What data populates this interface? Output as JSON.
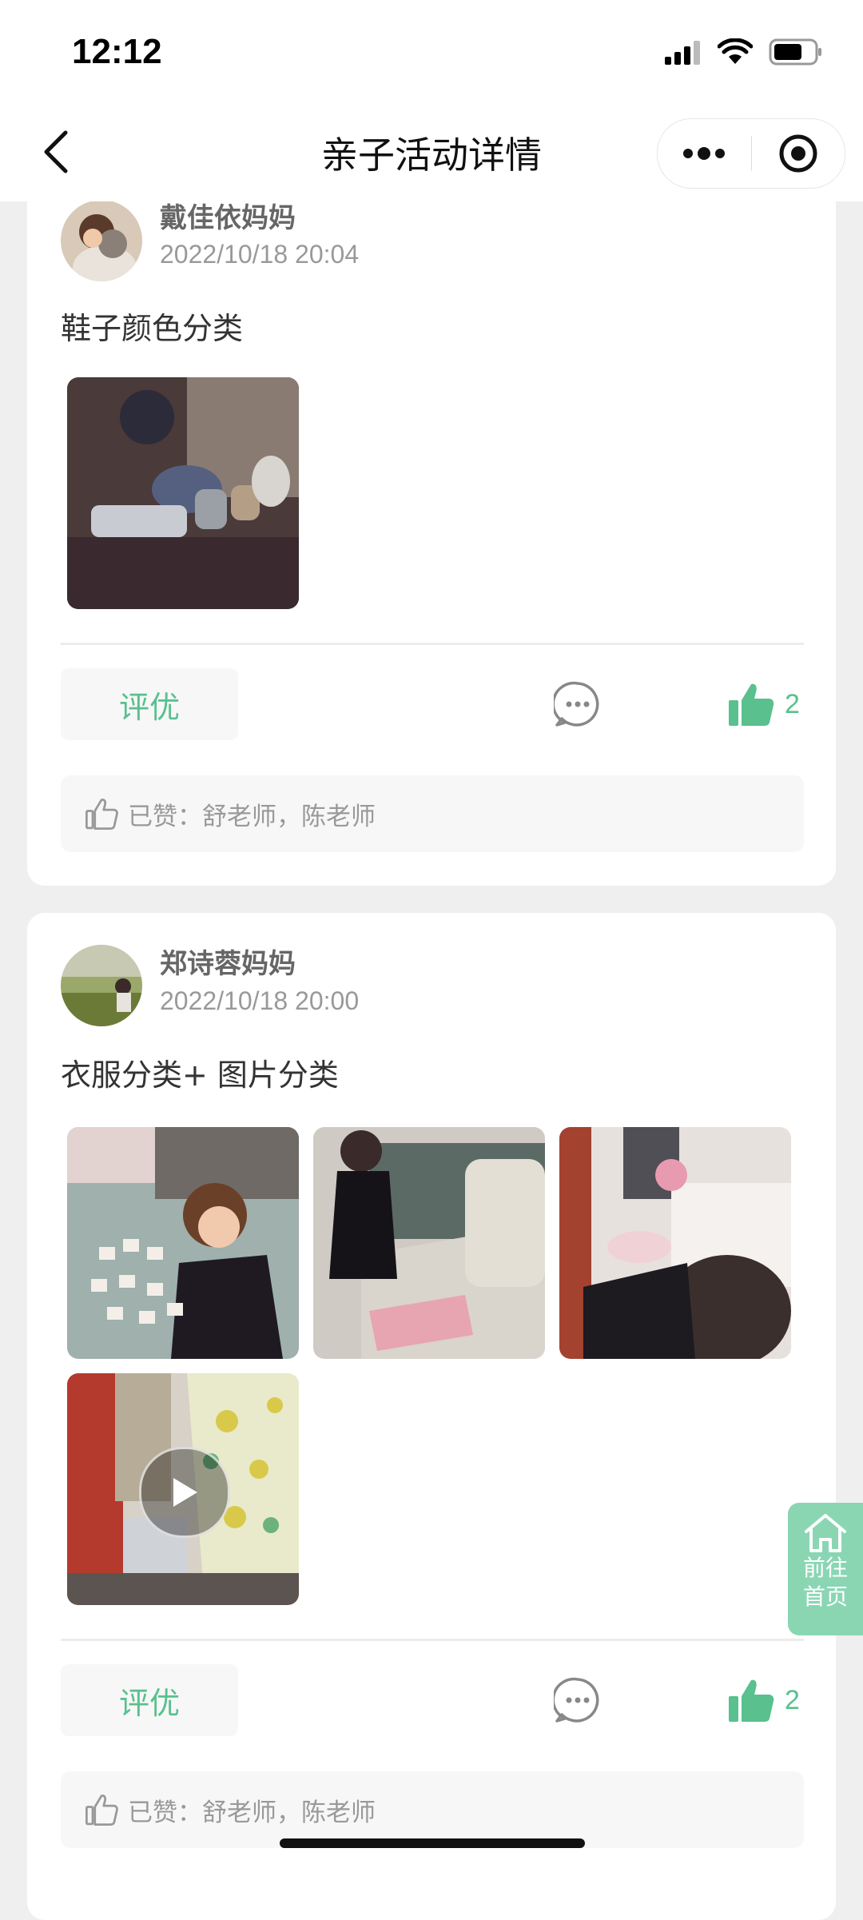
{
  "status_bar": {
    "time": "12:12"
  },
  "nav": {
    "title": "亲子活动详情"
  },
  "posts": [
    {
      "author": "戴佳依妈妈",
      "date": "2022/10/18 20:04",
      "text": "鞋子颜色分类",
      "rate_label": "评优",
      "like_count": "2",
      "likes_text": "已赞：舒老师，陈老师"
    },
    {
      "author": "郑诗蓉妈妈",
      "date": "2022/10/18 20:00",
      "text": "衣服分类+ 图片分类",
      "rate_label": "评优",
      "like_count": "2",
      "likes_text": "已赞：舒老师，陈老师"
    }
  ],
  "home_button": {
    "line1": "前往",
    "line2": "首页"
  },
  "colors": {
    "accent": "#59c08e",
    "home_button_bg": "#8ad6b3",
    "page_bg": "#efefef"
  }
}
